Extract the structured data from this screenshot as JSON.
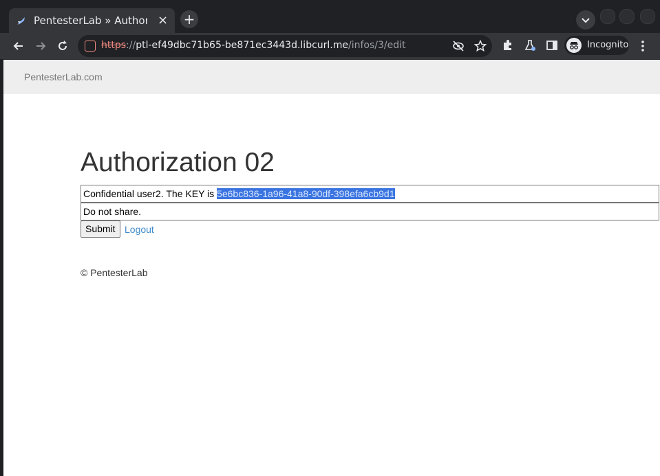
{
  "browser": {
    "tab_title": "PentesterLab » Authorization",
    "new_tab_label": "+",
    "close_tab_label": "×",
    "url": {
      "scheme": "https",
      "separator": "://",
      "host": "ptl-ef49dbc71b65-be871ec3443d.libcurl.me",
      "path": "/infos/3/edit"
    },
    "profile_label": "Incognito"
  },
  "site": {
    "brand": "PentesterLab.com",
    "heading": "Authorization 02",
    "info_field": {
      "prefix": "Confidential user2. The KEY is ",
      "selected": "5e6bc836-1a96-41a8-90df-398efa6cb9d1"
    },
    "note_field": "Do not share.",
    "submit_label": "Submit",
    "logout_label": "Logout",
    "footer": "© PentesterLab"
  },
  "colors": {
    "chrome_bg": "#202124",
    "toolbar_bg": "#35363a",
    "insecure_scheme": "#f28b82",
    "selection": "#3a74e0",
    "link": "#428bca"
  }
}
